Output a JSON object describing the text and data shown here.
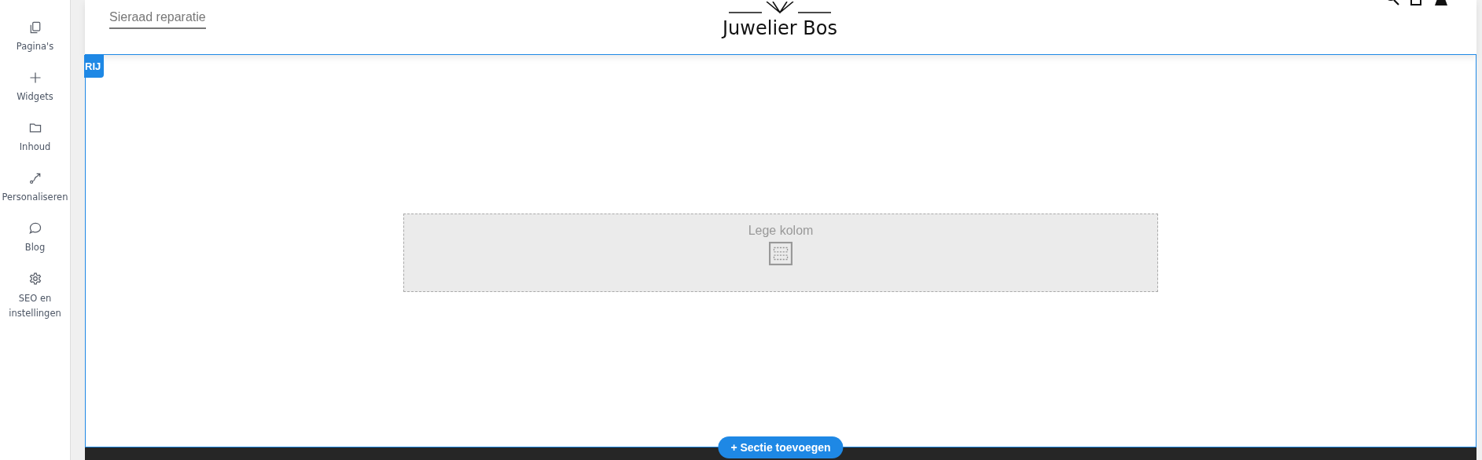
{
  "sidebar": {
    "items": [
      {
        "label": "Pagina's",
        "kind": "pages"
      },
      {
        "label": "Widgets",
        "kind": "plus"
      },
      {
        "label": "Inhoud",
        "kind": "folder"
      },
      {
        "label": "Personaliseren",
        "kind": "route"
      },
      {
        "label": "Blog",
        "kind": "chat"
      },
      {
        "label": "SEO en instellingen",
        "kind": "gear"
      }
    ]
  },
  "header": {
    "nav_link": "Sieraad reparatie",
    "logo": "Juwelier Bos"
  },
  "row": {
    "badge": "RIJ",
    "column": {
      "label": "Lege kolom"
    }
  },
  "add_section_button": "+ Sectie toevoegen"
}
